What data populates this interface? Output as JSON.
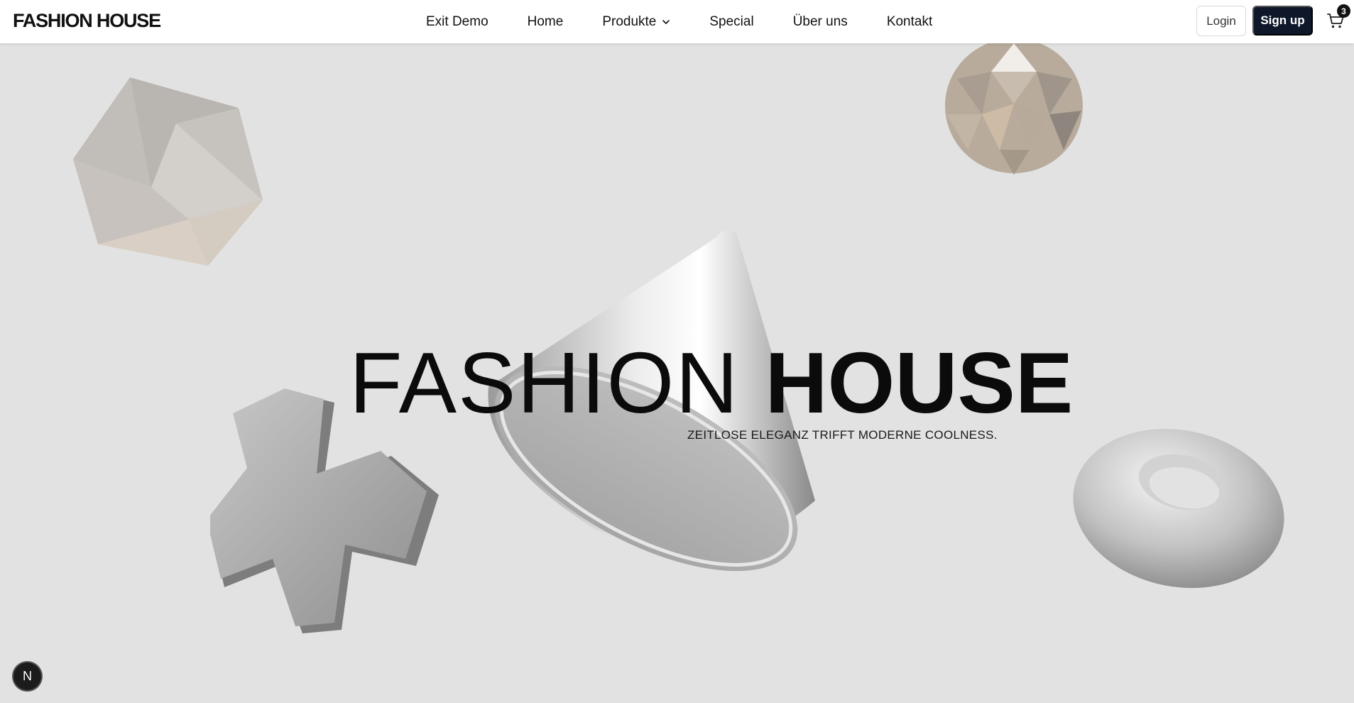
{
  "brand": "FASHION HOUSE",
  "nav": [
    {
      "label": "Exit Demo"
    },
    {
      "label": "Home"
    },
    {
      "label": "Produkte",
      "has_dropdown": true
    },
    {
      "label": "Special"
    },
    {
      "label": "Über uns"
    },
    {
      "label": "Kontakt"
    }
  ],
  "auth": {
    "login": "Login",
    "signup": "Sign up"
  },
  "cart": {
    "count": "3",
    "icon": "cart-icon"
  },
  "hero": {
    "title_light": "FASHION",
    "title_bold": "HOUSE",
    "subtitle": "ZEITLOSE ELEGANZ TRIFFT MODERNE COOLNESS."
  },
  "dev_badge": "N",
  "colors": {
    "background": "#e2e2e2",
    "navbar": "#ffffff",
    "signup_button": "#0f172a",
    "text": "#111111"
  }
}
